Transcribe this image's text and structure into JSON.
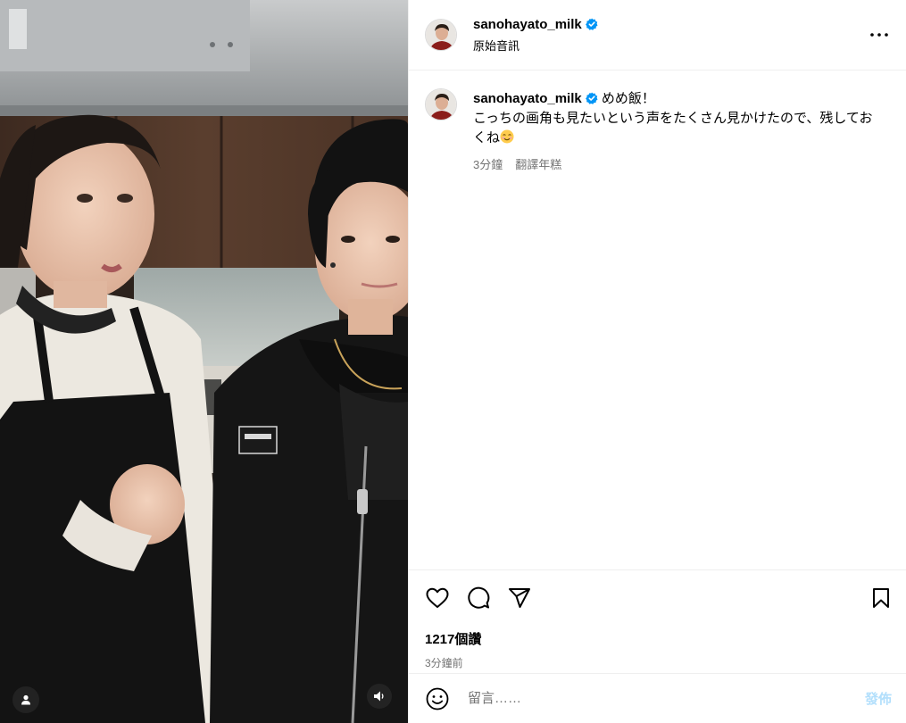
{
  "post": {
    "username": "sanohayato_milk",
    "audio_label": "原始音訊",
    "verified": true,
    "more_icon": "more-horizontal-icon"
  },
  "caption": {
    "username": "sanohayato_milk",
    "text_line1": "めめ飯！",
    "text_line2": "こっちの画角も見たいという声をたくさん見かけたので、残しておくね",
    "emoji": "smiling-face-icon",
    "time": "3分鐘",
    "translate_label": "翻譯年糕"
  },
  "actions": {
    "icons": [
      "heart-icon",
      "comment-icon",
      "share-icon",
      "bookmark-icon"
    ],
    "likes": "1217個讚",
    "time_ago": "3分鐘前"
  },
  "comment": {
    "placeholder": "留言……",
    "post_label": "發佈",
    "emoji_icon": "emoji-icon"
  },
  "media": {
    "tag_icon": "user-tag-icon",
    "audio_icon": "speaker-icon"
  },
  "colors": {
    "verified_blue": "#0095f6",
    "secondary_text": "#737373",
    "post_button_disabled": "#b2dffc",
    "divider": "#efefef"
  }
}
